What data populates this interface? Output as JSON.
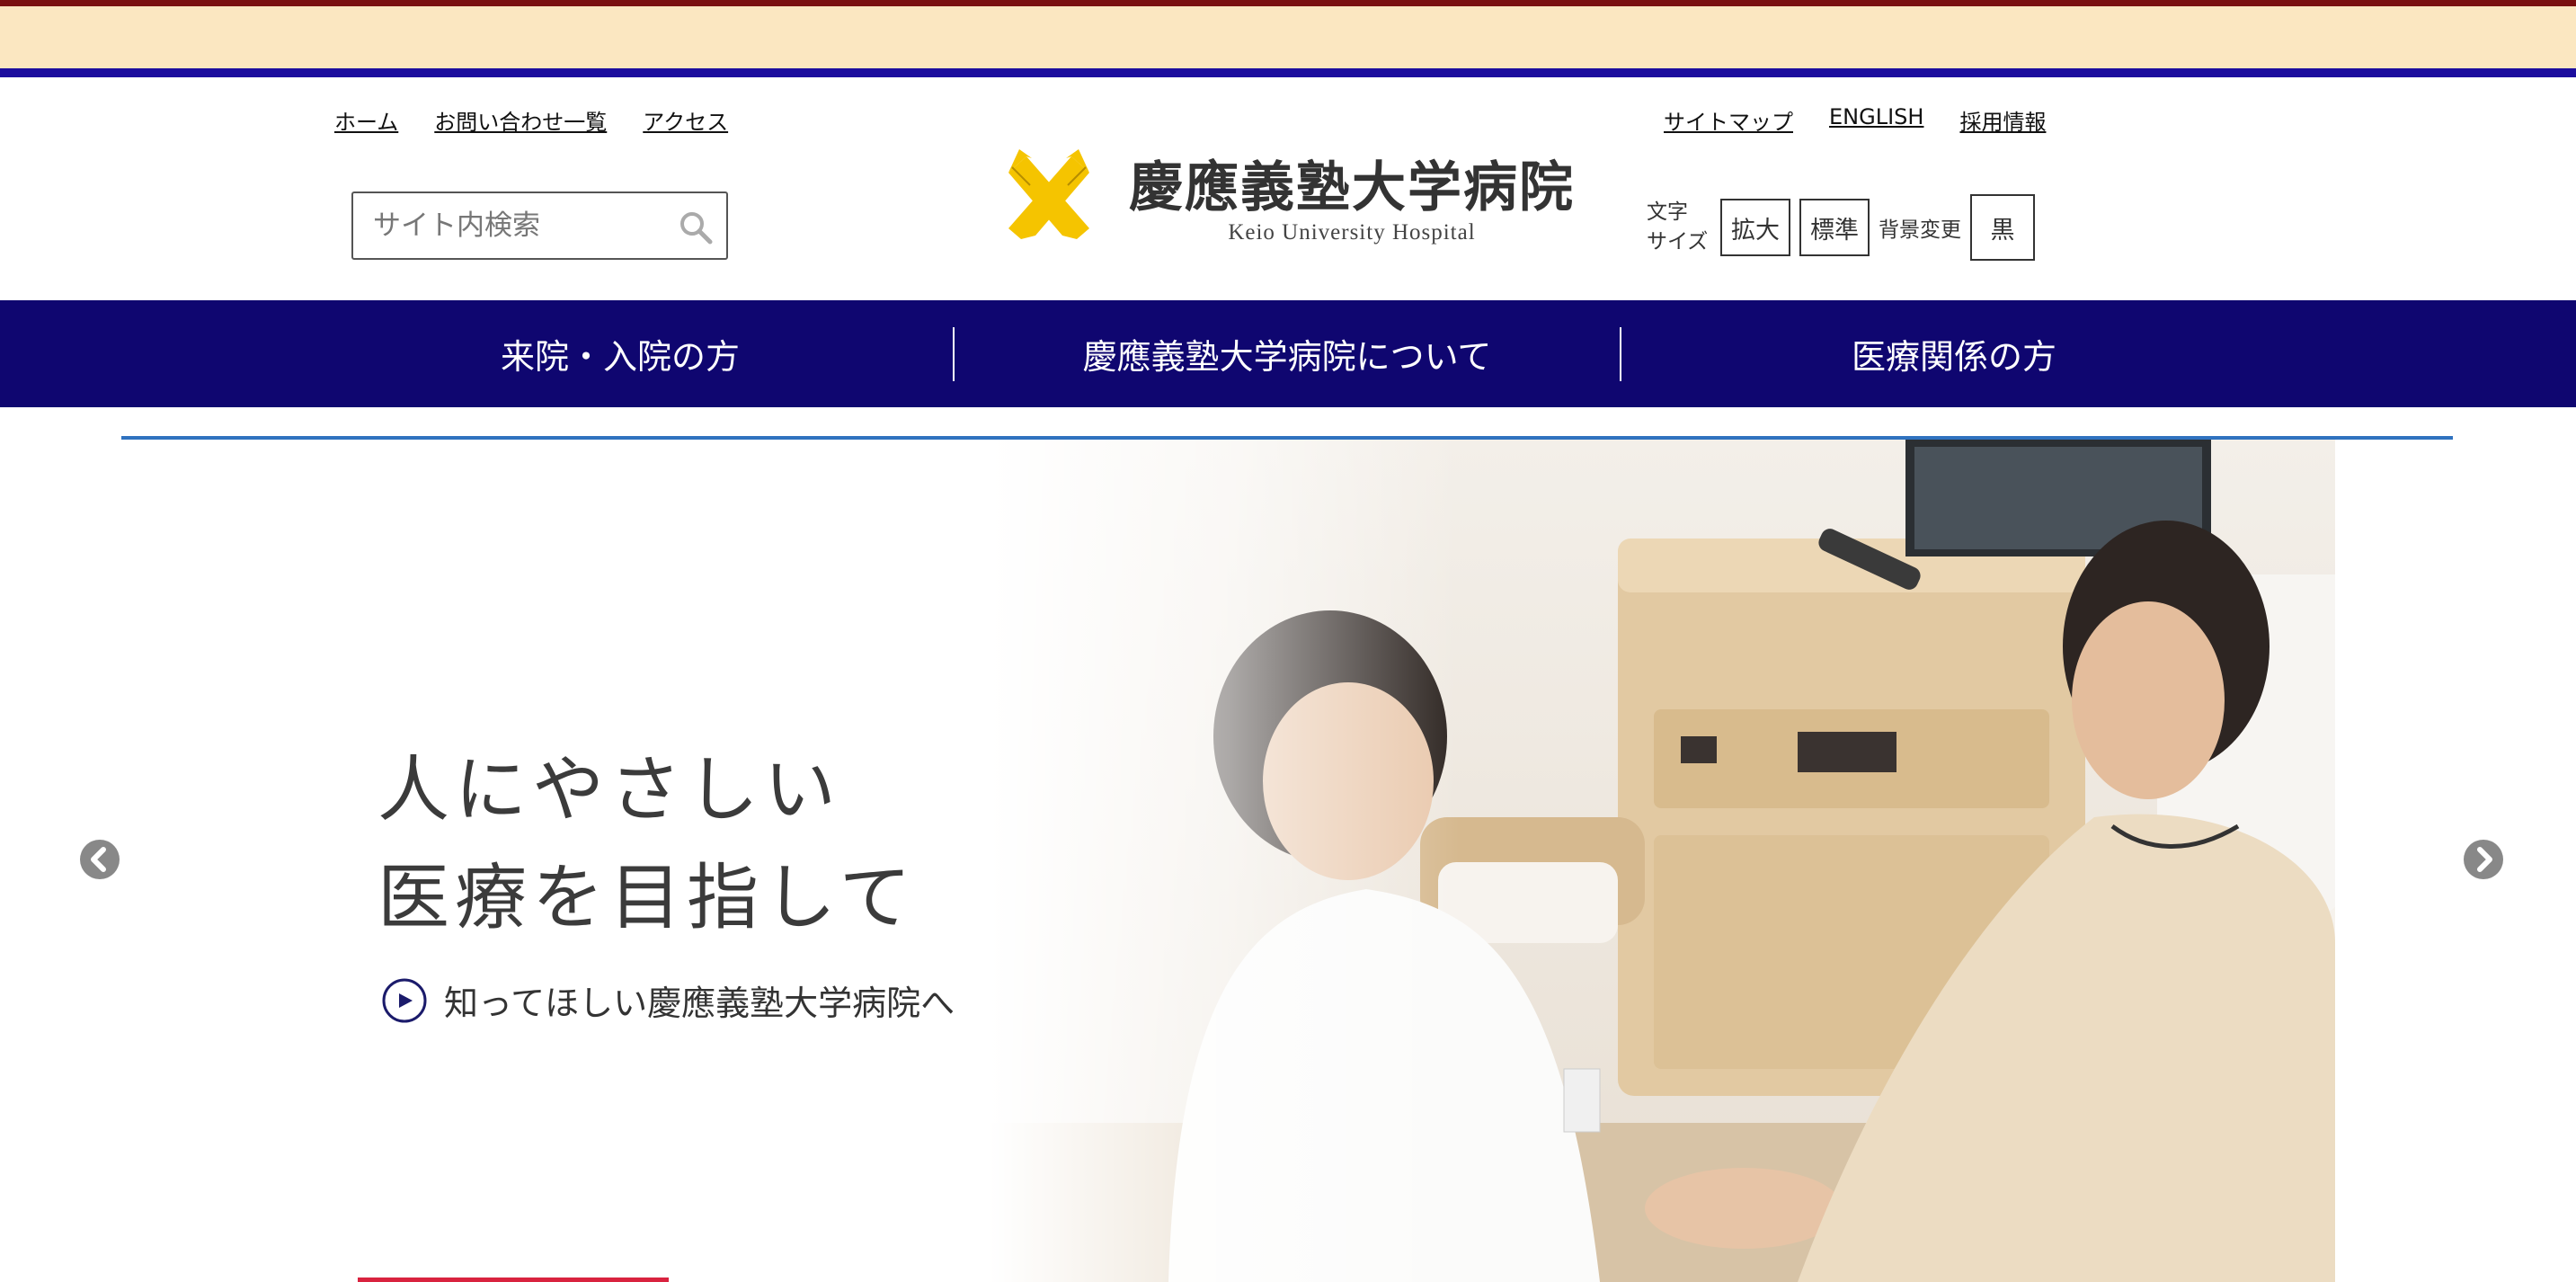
{
  "colors": {
    "banner_bg": "#fbe7c1",
    "banner_top": "#7a1010",
    "banner_bottom": "#1c0d9e",
    "nav_bg": "#0f0670",
    "hero_rule": "#2f72bf",
    "logo_gold": "#f5c400"
  },
  "utility_left": [
    {
      "label": "ホーム"
    },
    {
      "label": "お問い合わせ一覧"
    },
    {
      "label": "アクセス"
    }
  ],
  "utility_right": [
    {
      "label": "サイトマップ"
    },
    {
      "label": "ENGLISH"
    },
    {
      "label": "採用情報"
    }
  ],
  "search": {
    "placeholder": "サイト内検索",
    "icon": "search-icon"
  },
  "logo": {
    "name_ja": "慶應義塾大学病院",
    "name_en": "Keio University Hospital"
  },
  "text_size": {
    "label_line1": "文字",
    "label_line2": "サイズ",
    "enlarge": "拡大",
    "standard": "標準",
    "bg_label": "背景変更",
    "black": "黒"
  },
  "main_nav": [
    {
      "label": "来院・入院の方"
    },
    {
      "label": "慶應義塾大学病院について"
    },
    {
      "label": "医療関係の方"
    }
  ],
  "hero": {
    "headline_line1": "人にやさしい",
    "headline_line2": "医療を目指して",
    "link_text": "知ってほしい慶應義塾大学病院へ",
    "prev_icon": "chevron-left-icon",
    "next_icon": "chevron-right-icon"
  }
}
